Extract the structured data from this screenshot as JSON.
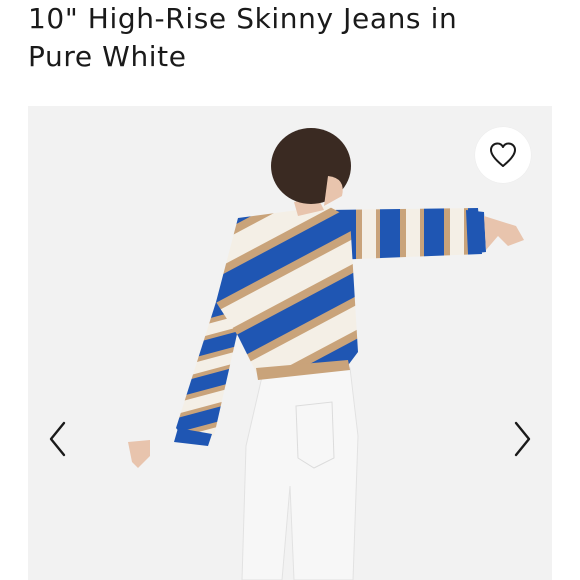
{
  "product": {
    "title_line1": "10\" High-Rise Skinny Jeans in",
    "title_line2": "Pure White"
  },
  "gallery": {
    "favorite_icon": "heart-icon",
    "prev_icon": "chevron-left-icon",
    "next_icon": "chevron-right-icon"
  },
  "colors": {
    "sweater_blue": "#1f56b3",
    "sweater_tan": "#c9a37a",
    "sweater_cream": "#f4efe6",
    "jeans_white": "#f7f7f7",
    "background": "#f2f2f2",
    "text": "#1a1a1a"
  }
}
